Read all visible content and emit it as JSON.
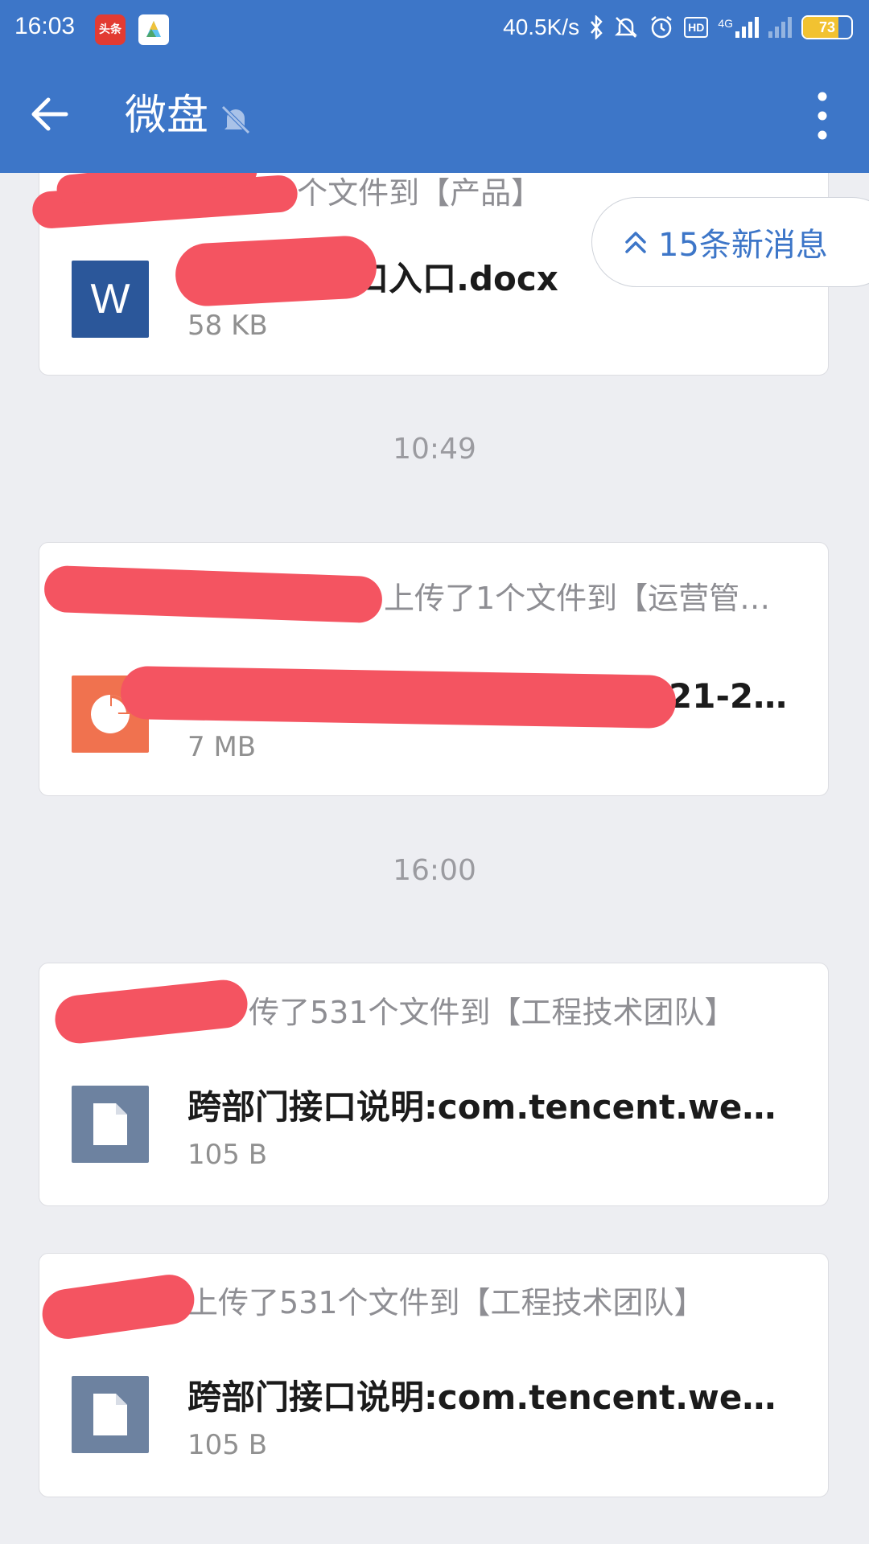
{
  "status_bar": {
    "time": "16:03",
    "app1_label": "头条",
    "network_speed": "40.5K/s",
    "hd": "HD",
    "signal": "4G",
    "battery": "73",
    "battery_fraction": 0.73,
    "icons": [
      "bluetooth-icon",
      "mute-icon",
      "alarm-icon",
      "hd-icon",
      "signal-4g-icon",
      "signal-icon",
      "battery-icon"
    ]
  },
  "toolbar": {
    "title": "微盘",
    "icons": [
      "back-arrow-icon",
      "notification-off-icon",
      "more-vertical-icon"
    ]
  },
  "new_messages": {
    "label": "15条新消息",
    "icon": "double-chevron-up-icon"
  },
  "feed": {
    "cards": [
      {
        "header": "传了1个文件到【产品】",
        "file_name": "口入口.docx",
        "file_size": "58 KB",
        "file_type": "word",
        "icon_letter": "W",
        "icon_color": "#2b579a"
      },
      {
        "header": "）上传了1个文件到【运营管…",
        "file_name": "21-2-…",
        "file_size": "7 MB",
        "file_type": "ppt",
        "icon_color": "#f0724f"
      },
      {
        "header": "传了531个文件到【工程技术团队】",
        "file_name": "跨部门接口说明:com.tencent.wed…",
        "file_size": "105 B",
        "file_type": "generic",
        "icon_color": "#6d82a0"
      },
      {
        "header": "上传了531个文件到【工程技术团队】",
        "file_name": "跨部门接口说明:com.tencent.wed…",
        "file_size": "105 B",
        "file_type": "generic",
        "icon_color": "#6d82a0"
      }
    ],
    "timestamps": [
      "10:49",
      "16:00"
    ]
  },
  "colors": {
    "appbar": "#3d76c8",
    "background": "#edeef2",
    "redaction": "#f45461"
  }
}
